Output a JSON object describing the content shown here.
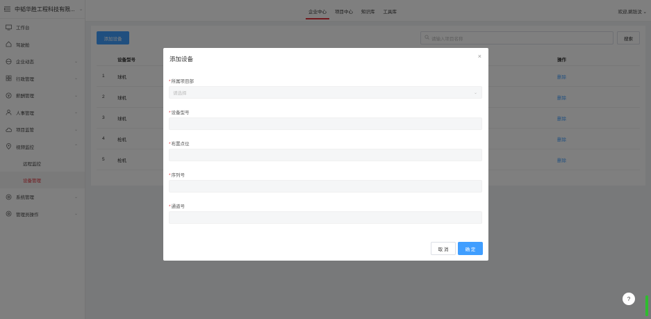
{
  "sidebar": {
    "company": "中韬华胜工程科技有限...",
    "items": [
      {
        "label": "工作台",
        "icon": "monitor-icon",
        "arrow": ""
      },
      {
        "label": "驾驶舱",
        "icon": "home-icon",
        "arrow": ""
      },
      {
        "label": "企业动态",
        "icon": "globe-icon",
        "arrow": "⌄"
      },
      {
        "label": "行政管理",
        "icon": "grid-icon",
        "arrow": "⌄"
      },
      {
        "label": "薪酬管理",
        "icon": "money-icon",
        "arrow": "⌄"
      },
      {
        "label": "人事管理",
        "icon": "user-icon",
        "arrow": "⌄"
      },
      {
        "label": "项目监管",
        "icon": "cloud-icon",
        "arrow": "⌄"
      },
      {
        "label": "视频监控",
        "icon": "location-icon",
        "arrow": "⌃"
      }
    ],
    "sub_items": [
      {
        "label": "远程监控"
      },
      {
        "label": "设备管理"
      }
    ],
    "bottom_items": [
      {
        "label": "系统管理",
        "icon": "settings-icon",
        "arrow": "⌄"
      },
      {
        "label": "管理员操作",
        "icon": "settings-icon",
        "arrow": "⌄"
      }
    ]
  },
  "topbar": {
    "tabs": [
      "企业中心",
      "项目中心",
      "知识库",
      "工具库"
    ],
    "active_tab": 0,
    "welcome": "欢迎,姚铨汶 ⌄"
  },
  "toolbar": {
    "add_label": "添加设备",
    "search_placeholder": "请输入项目名称",
    "search_label": "搜索"
  },
  "table": {
    "headers": {
      "type": "设备型号",
      "op": "操作"
    },
    "rows": [
      {
        "idx": "1",
        "type": "球机",
        "op": "删除"
      },
      {
        "idx": "2",
        "type": "球机",
        "op": "删除"
      },
      {
        "idx": "3",
        "type": "球机",
        "op": "删除"
      },
      {
        "idx": "4",
        "type": "枪机",
        "op": "删除"
      },
      {
        "idx": "5",
        "type": "枪机",
        "op": "删除"
      }
    ]
  },
  "dialog": {
    "title": "添加设备",
    "fields": [
      {
        "label": "所属项目部",
        "placeholder": "请选择",
        "select": true
      },
      {
        "label": "设备型号",
        "placeholder": "",
        "select": false
      },
      {
        "label": "布置点位",
        "placeholder": "",
        "select": false
      },
      {
        "label": "序列号",
        "placeholder": "",
        "select": false
      },
      {
        "label": "通道号",
        "placeholder": "",
        "select": false
      }
    ],
    "cancel_label": "取 消",
    "ok_label": "确 定"
  },
  "help_label": "?",
  "colors": {
    "accent": "#409eff",
    "active": "#e0303a",
    "overlay": "rgba(0,0,0,0.5)"
  }
}
